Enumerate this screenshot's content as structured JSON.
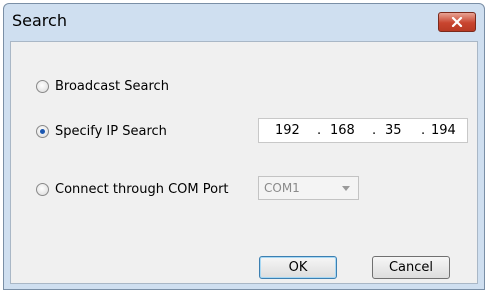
{
  "window": {
    "title": "Search"
  },
  "options": [
    {
      "label": "Broadcast Search",
      "selected": false
    },
    {
      "label": "Specify IP Search",
      "selected": true
    },
    {
      "label": "Connect through COM Port",
      "selected": false
    }
  ],
  "ip": {
    "o1": "192",
    "o2": "168",
    "o3": "35",
    "o4": "194",
    "sep": "."
  },
  "com_port": {
    "value": "COM1"
  },
  "buttons": {
    "ok": "OK",
    "cancel": "Cancel"
  },
  "icons": {
    "close": "close-icon",
    "dropdown": "chevron-down-icon"
  }
}
